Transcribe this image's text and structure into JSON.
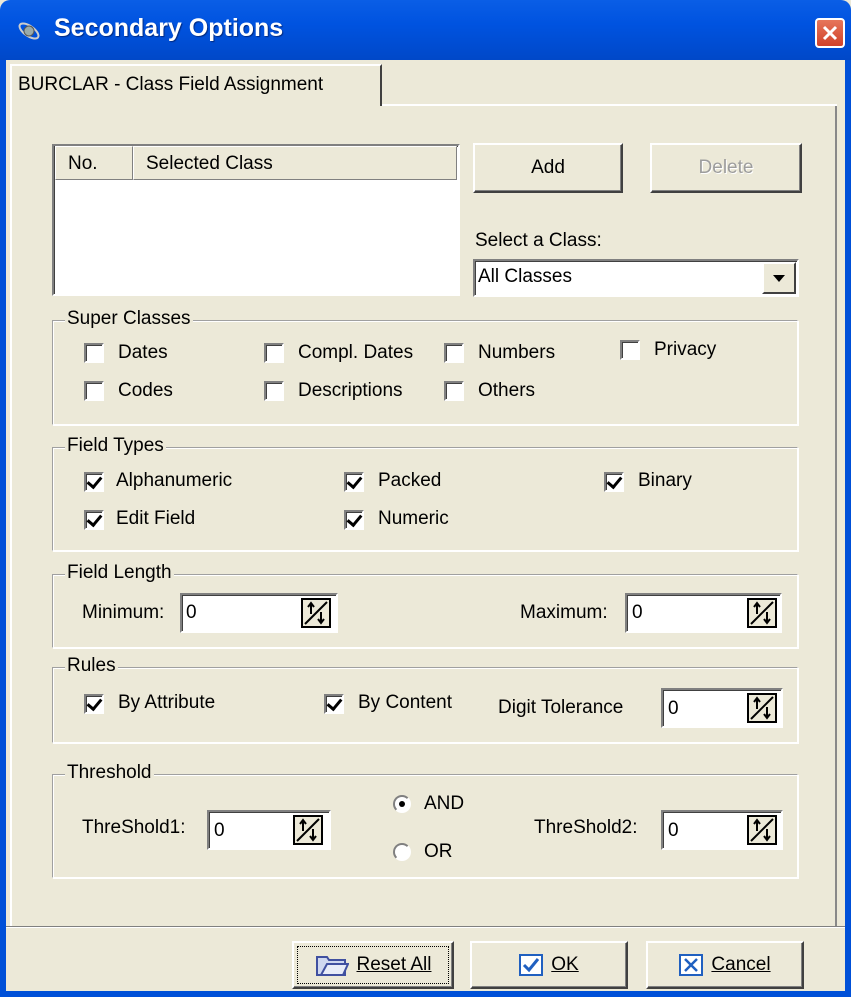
{
  "window": {
    "title": "Secondary Options",
    "title_icon": "satellite-icon",
    "close_icon": "close-icon"
  },
  "tab": {
    "label": "BURCLAR - Class Field Assignment"
  },
  "class_list": {
    "columns": [
      "No.",
      "Selected Class"
    ],
    "rows": []
  },
  "buttons": {
    "add": "Add",
    "delete": "Delete"
  },
  "class_select": {
    "label": "Select a Class:",
    "value": "All Classes"
  },
  "super_classes": {
    "title": "Super Classes",
    "items": [
      {
        "label": "Dates",
        "checked": false
      },
      {
        "label": "Compl. Dates",
        "checked": false
      },
      {
        "label": "Numbers",
        "checked": false
      },
      {
        "label": "Privacy",
        "checked": false
      },
      {
        "label": "Codes",
        "checked": false
      },
      {
        "label": "Descriptions",
        "checked": false
      },
      {
        "label": "Others",
        "checked": false
      }
    ]
  },
  "field_types": {
    "title": "Field Types",
    "items": [
      {
        "label": "Alphanumeric",
        "checked": true
      },
      {
        "label": "Packed",
        "checked": true
      },
      {
        "label": "Binary",
        "checked": true
      },
      {
        "label": "Edit Field",
        "checked": true
      },
      {
        "label": "Numeric",
        "checked": true
      }
    ]
  },
  "field_length": {
    "title": "Field Length",
    "min_label": "Minimum:",
    "min_value": "0",
    "max_label": "Maximum:",
    "max_value": "0"
  },
  "rules": {
    "title": "Rules",
    "by_attribute": {
      "label": "By Attribute",
      "checked": true
    },
    "by_content": {
      "label": "By Content",
      "checked": true
    },
    "digit_tolerance_label": "Digit Tolerance",
    "digit_tolerance_value": "0"
  },
  "threshold": {
    "title": "Threshold",
    "t1_label": "ThreShold1:",
    "t1_value": "0",
    "t2_label": "ThreShold2:",
    "t2_value": "0",
    "and_label": "AND",
    "or_label": "OR",
    "selected": "AND"
  },
  "footer": {
    "reset_all": "Reset All",
    "ok": "OK",
    "cancel": "Cancel"
  }
}
